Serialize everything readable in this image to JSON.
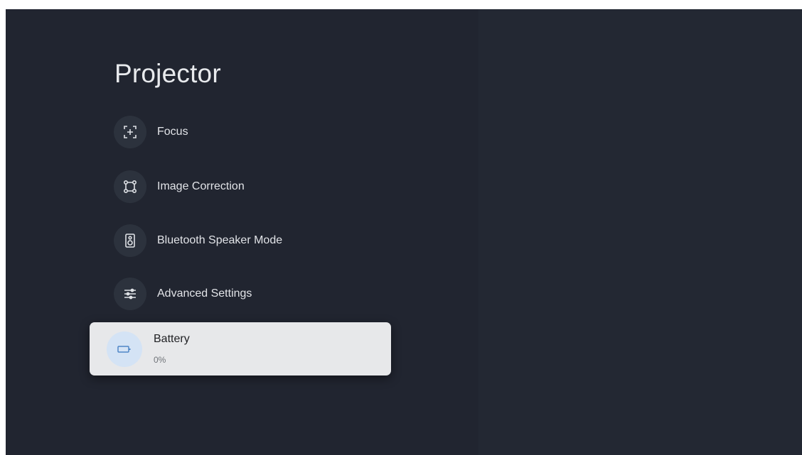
{
  "page": {
    "title": "Projector"
  },
  "menu": {
    "items": [
      {
        "label": "Focus",
        "icon": "focus-icon"
      },
      {
        "label": "Image Correction",
        "icon": "image-correction-icon"
      },
      {
        "label": "Bluetooth Speaker Mode",
        "icon": "speaker-icon"
      },
      {
        "label": "Advanced Settings",
        "icon": "sliders-icon"
      }
    ],
    "selected": {
      "label": "Battery",
      "value": "0%",
      "icon": "battery-icon"
    }
  },
  "colors": {
    "background": "#222732",
    "icon_circle": "#2c323d",
    "focused_card": "#e7e8ea",
    "focused_icon_circle": "#d4e3f5",
    "focused_icon": "#4f86c6",
    "text": "#e2e4e8"
  }
}
